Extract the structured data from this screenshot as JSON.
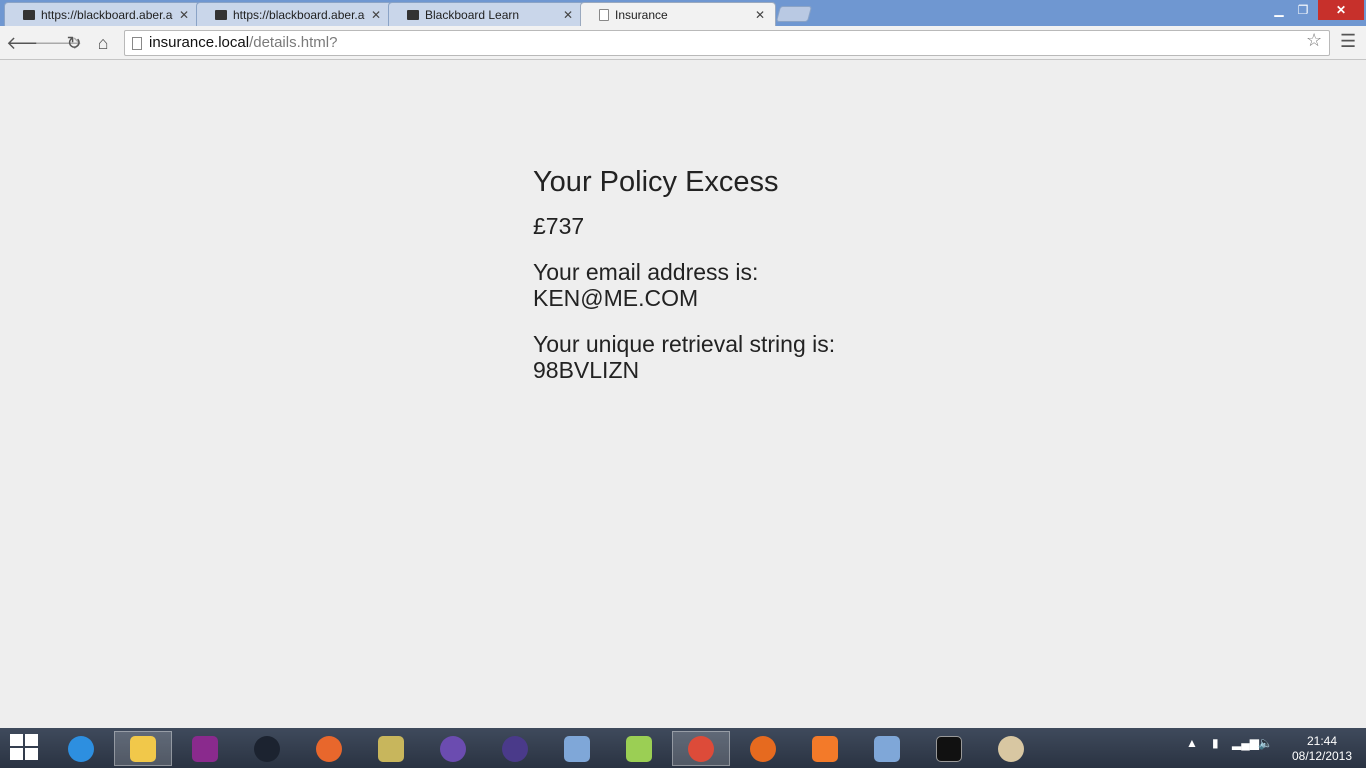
{
  "tabs": [
    {
      "label": "https://blackboard.aber.ac",
      "active": false
    },
    {
      "label": "https://blackboard.aber.ac",
      "active": false
    },
    {
      "label": "Blackboard Learn",
      "active": false
    },
    {
      "label": "Insurance",
      "active": true
    }
  ],
  "toolbar": {
    "url_host": "insurance.local",
    "url_path": "/details.html?"
  },
  "page": {
    "heading": "Your Policy Excess",
    "excess": "£737",
    "email_text": "Your email address is: KEN@ME.COM",
    "retrieval_text": "Your unique retrieval string is: 98BVLIZN"
  },
  "taskbar": {
    "icons": [
      "internet-explorer-icon",
      "file-explorer-icon",
      "onenote-icon",
      "steam-icon",
      "origin-icon",
      "tools-icon",
      "visual-studio-icon",
      "eclipse-icon",
      "virtualbox-icon",
      "notepad-plus-plus-icon",
      "chrome-icon",
      "firefox-icon",
      "xampp-icon",
      "virtualbox-icon-2",
      "command-prompt-icon",
      "paint-icon"
    ],
    "time": "21:44",
    "date": "08/12/2013"
  },
  "colors": {
    "titlebar": "#6f97d1",
    "page_background": "#eeeeee",
    "text": "#222222",
    "close_button": "#c7302b"
  }
}
